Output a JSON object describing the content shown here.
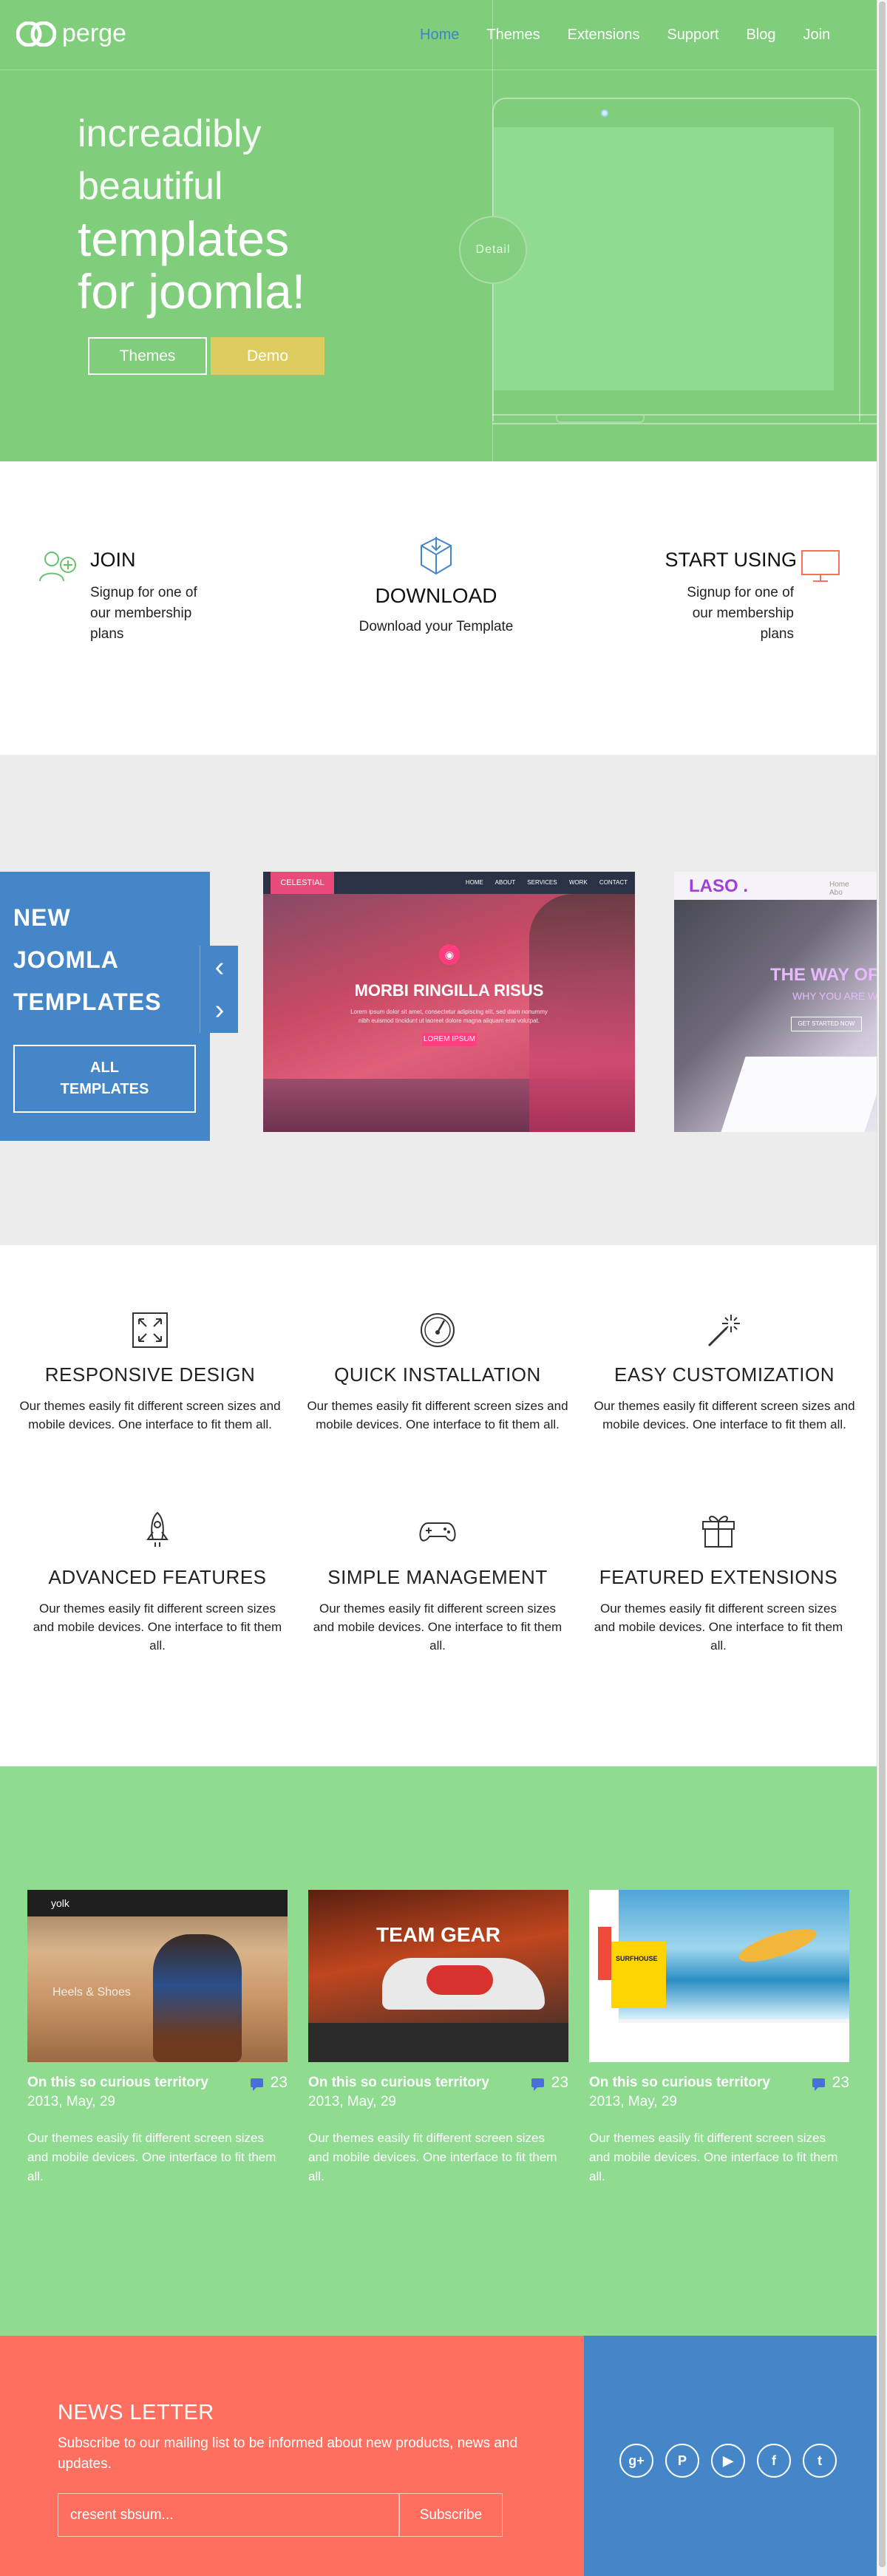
{
  "header": {
    "logo_text": "perge",
    "nav": [
      {
        "label": "Home",
        "active": true
      },
      {
        "label": "Themes"
      },
      {
        "label": "Extensions"
      },
      {
        "label": "Support"
      },
      {
        "label": "Blog"
      },
      {
        "label": "Join"
      }
    ]
  },
  "hero": {
    "line1": "increadibly",
    "line2": "beautiful",
    "line3": "templates",
    "line4": "for joomla!",
    "themes_button": "Themes",
    "demo_button": "Demo",
    "detail_button": "Detail"
  },
  "steps": [
    {
      "title": "JOIN",
      "desc": "Signup for one of our membership plans",
      "icon": "add-user-icon"
    },
    {
      "title": "DOWNLOAD",
      "desc": "Download your Template",
      "icon": "download-box-icon"
    },
    {
      "title": "START USING",
      "desc": "Signup for one of our membership plans",
      "icon": "monitor-icon"
    }
  ],
  "templates": {
    "heading": [
      "NEW",
      "JOOMLA",
      "TEMPLATES"
    ],
    "all_button": [
      "ALL",
      "TEMPLATES"
    ],
    "prev_arrow": "‹",
    "next_arrow": "›",
    "shot1": {
      "brand": "CELESTIAL",
      "menu": "HOME ABOUT SERVICES WORK CONTACT",
      "title": "MORBI RINGILLA RISUS",
      "subtitle": "Lorem ipsum dolor sit amet, consectetur adipiscing elit, sed diam nonummy nibh euismod tincidunt ut laoreet dolore magna aliquam erat volutpat.",
      "cta": "LOREM IPSUM"
    },
    "shot2": {
      "logo": "LASO .",
      "menu": "Home Abo",
      "headline": "THE WAY OF S",
      "sub": "WHY YOU ARE W",
      "cta": "GET STARTED NOW"
    }
  },
  "features": [
    {
      "title": "RESPONSIVE DESIGN",
      "desc": "Our themes easily fit different screen sizes and mobile devices. One interface to fit them all.",
      "icon": "expand-icon"
    },
    {
      "title": "QUICK INSTALLATION",
      "desc": "Our themes easily fit different screen sizes and mobile devices. One interface to fit them all.",
      "icon": "speedometer-icon"
    },
    {
      "title": "EASY CUSTOMIZATION",
      "desc": "Our themes easily fit different screen sizes and mobile devices. One interface to fit them all.",
      "icon": "magic-wand-icon"
    },
    {
      "title": "ADVANCED FEATURES",
      "desc": "Our themes easily fit different screen sizes and mobile devices. One interface to fit them all.",
      "icon": "rocket-icon"
    },
    {
      "title": "SIMPLE MANAGEMENT",
      "desc": "Our themes easily fit different screen sizes and mobile devices. One interface to fit them all.",
      "icon": "gamepad-icon"
    },
    {
      "title": "FEATURED EXTENSIONS",
      "desc": "Our themes easily fit different screen sizes and mobile devices. One interface to fit them all.",
      "icon": "gift-icon"
    }
  ],
  "posts": [
    {
      "title": "On this so curious territory",
      "date": "2013, May, 29",
      "comments": "23",
      "excerpt": "Our themes easily fit different screen sizes and mobile devices. One interface to fit them all.",
      "img_brand": "yolk",
      "img_text": "Heels & Shoes"
    },
    {
      "title": "On this so curious territory",
      "date": "2013, May, 29",
      "comments": "23",
      "excerpt": "Our themes easily fit different screen sizes and mobile devices. One interface to fit them all.",
      "img_brand": "TEAM GEAR"
    },
    {
      "title": "On this so curious territory",
      "date": "2013, May, 29",
      "comments": "23",
      "excerpt": "Our themes easily fit different screen sizes and mobile devices. One interface to fit them all.",
      "img_brand": "SURFHOUSE"
    }
  ],
  "newsletter": {
    "title": "NEWS LETTER",
    "desc": "Subscribe to our mailing list to be informed about new products, news and updates.",
    "input_value": "cresent sbsum...",
    "subscribe_button": "Subscribe"
  },
  "social": [
    {
      "name": "google-plus-icon",
      "glyph": "g+"
    },
    {
      "name": "pinterest-icon",
      "glyph": "P"
    },
    {
      "name": "youtube-icon",
      "glyph": "▶"
    },
    {
      "name": "facebook-icon",
      "glyph": "f"
    },
    {
      "name": "twitter-icon",
      "glyph": "t"
    }
  ],
  "colors": {
    "hero_green": "#80cd7c",
    "blog_green": "#8fdc91",
    "brand_blue": "#4486c8",
    "demo_yellow": "#dccd5e",
    "newsletter_coral": "#ff6f60"
  }
}
